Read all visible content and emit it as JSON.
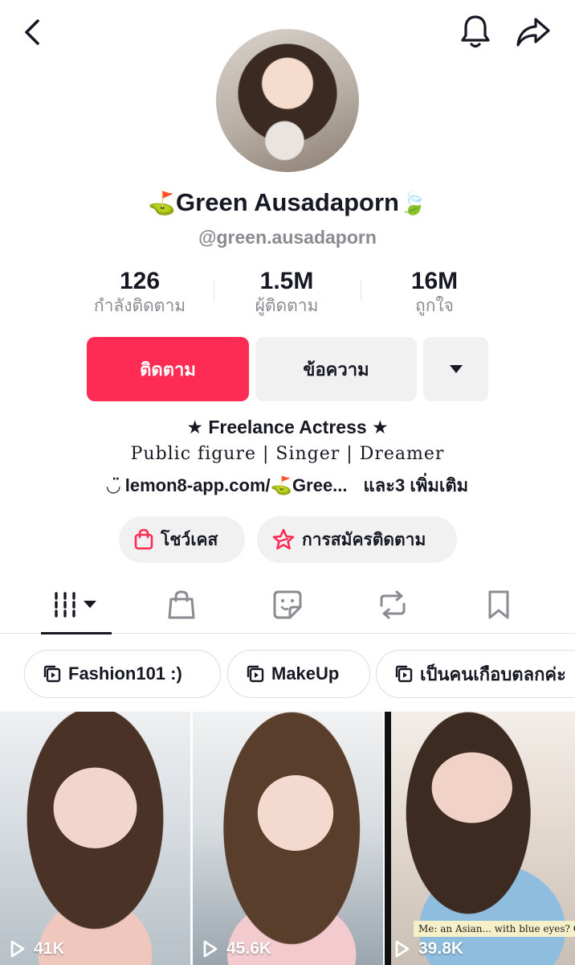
{
  "header": {
    "back_icon": "chevron-left-icon",
    "bell_icon": "bell-icon",
    "share_icon": "share-arrow-icon"
  },
  "profile": {
    "name_prefix_emoji": "⛳",
    "name": "Green Ausadaporn",
    "name_suffix_emoji": "🍃",
    "username": "@green.ausadaporn"
  },
  "stats": [
    {
      "value": "126",
      "label": "กำลังติดตาม"
    },
    {
      "value": "1.5M",
      "label": "ผู้ติดตาม"
    },
    {
      "value": "16M",
      "label": "ถูกใจ"
    }
  ],
  "actions": {
    "follow_label": "ติดตาม",
    "message_label": "ข้อความ"
  },
  "bio": {
    "title": "★ Freelance Actress ★",
    "line": "Public figure | Singer | Dreamer",
    "link_icon": "◡̈",
    "link_text": "lemon8-app.com/⛳Gree...",
    "more_text": "และ3 เพิ่มเติม"
  },
  "pills": {
    "showcase_label": "โชว์เคส",
    "subscribe_label": "การสมัครติดตาม"
  },
  "collections": [
    {
      "label": "Fashion101 :)"
    },
    {
      "label": "MakeUp"
    },
    {
      "label": "เป็นคนเกือบตลกค่ะ"
    }
  ],
  "videos": [
    {
      "views": "41K"
    },
    {
      "views": "45.6K"
    },
    {
      "views": "39.8K",
      "caption": "Me: an Asian... with blue eyes? Oops!"
    }
  ],
  "colors": {
    "accent": "#fe2c55",
    "button_bg": "#f1f1f2",
    "text_primary": "#161823",
    "text_secondary": "#8a8b91"
  }
}
